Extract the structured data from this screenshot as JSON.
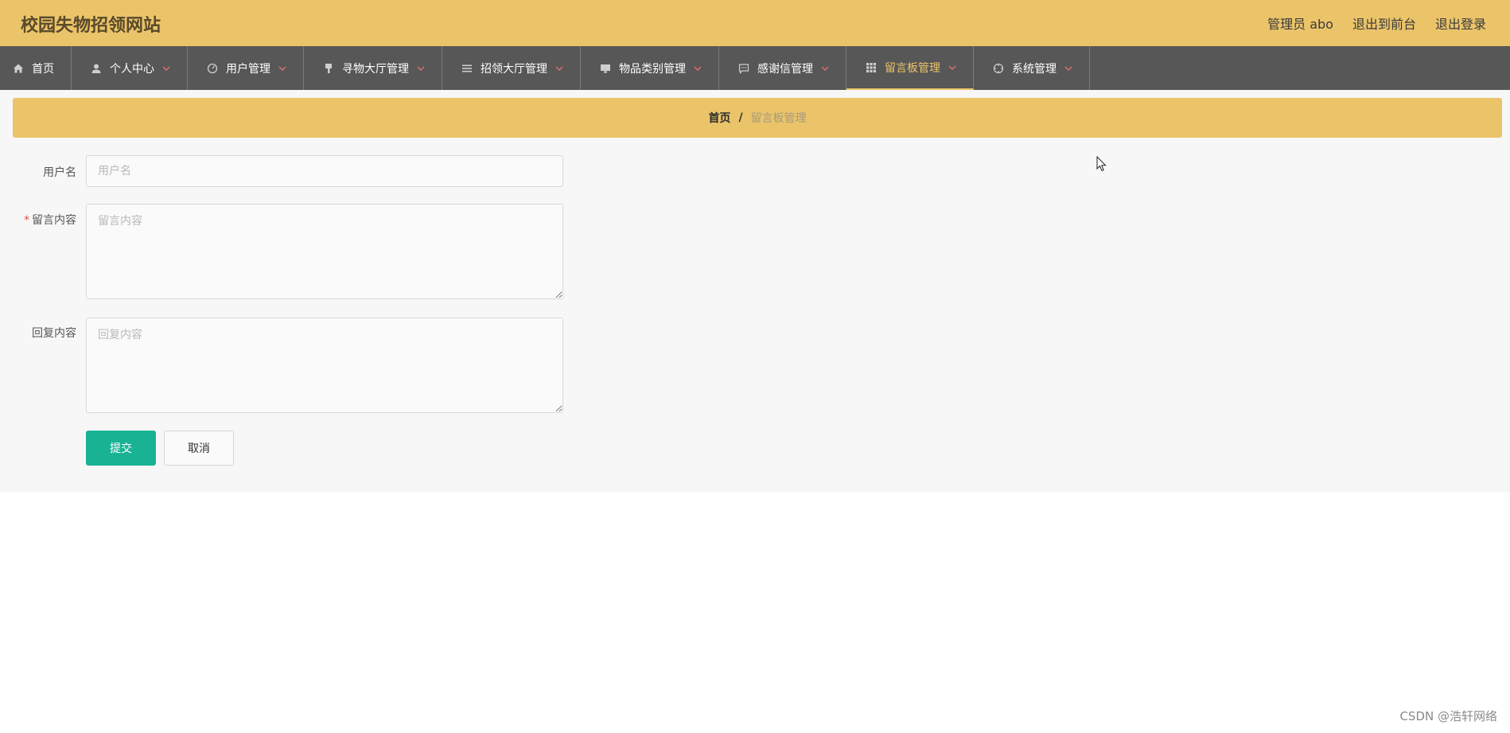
{
  "header": {
    "site_title": "校园失物招领网站",
    "admin_label": "管理员 abo",
    "exit_front_label": "退出到前台",
    "logout_label": "退出登录",
    "accent_color": "#ebc46a"
  },
  "nav": {
    "items": [
      {
        "label": "首页",
        "icon": "home-icon"
      },
      {
        "label": "个人中心",
        "icon": "user-icon"
      },
      {
        "label": "用户管理",
        "icon": "gauge-icon"
      },
      {
        "label": "寻物大厅管理",
        "icon": "brush-icon"
      },
      {
        "label": "招领大厅管理",
        "icon": "list-icon"
      },
      {
        "label": "物品类别管理",
        "icon": "monitor-icon"
      },
      {
        "label": "感谢信管理",
        "icon": "chat-icon"
      },
      {
        "label": "留言板管理",
        "icon": "grid-icon",
        "active": true
      },
      {
        "label": "系统管理",
        "icon": "crosshair-icon"
      }
    ]
  },
  "breadcrumb": {
    "home": "首页",
    "separator": "/",
    "current": "留言板管理"
  },
  "form": {
    "username": {
      "label": "用户名",
      "placeholder": "用户名",
      "value": ""
    },
    "message": {
      "label": "留言内容",
      "required_mark": "*",
      "placeholder": "留言内容",
      "value": ""
    },
    "reply": {
      "label": "回复内容",
      "placeholder": "回复内容",
      "value": ""
    },
    "submit_label": "提交",
    "cancel_label": "取消",
    "primary_color": "#19b394"
  },
  "watermark": "CSDN @浩轩网络"
}
